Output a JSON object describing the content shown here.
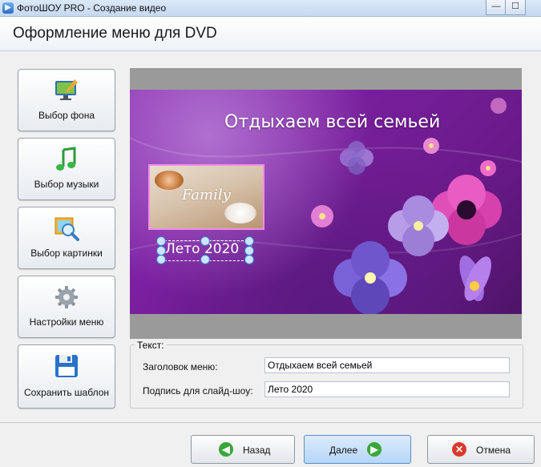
{
  "window": {
    "title": "ФотоШОУ PRO - Создание видео",
    "icon": "app-logo-icon",
    "min_label": "—",
    "max_label": "☐"
  },
  "header": {
    "title": "Оформление меню для DVD"
  },
  "sidebar": {
    "items": [
      {
        "label": "Выбор фона",
        "icon": "monitor-brush-icon"
      },
      {
        "label": "Выбор музыки",
        "icon": "music-note-icon"
      },
      {
        "label": "Выбор картинки",
        "icon": "picture-magnifier-icon"
      },
      {
        "label": "Настройки меню",
        "icon": "gear-icon"
      },
      {
        "label": "Сохранить шаблон",
        "icon": "floppy-disk-icon"
      }
    ]
  },
  "preview": {
    "menu_title": "Отдыхаем всей семьей",
    "thumbnail_text": "Family",
    "caption": "Лето 2020"
  },
  "text_panel": {
    "legend": "Текст:",
    "title_label": "Заголовок меню:",
    "title_value": "Отдыхаем всей семьей",
    "caption_label": "Подпись для слайд-шоу:",
    "caption_value": "Лето 2020"
  },
  "footer": {
    "back_label": "Назад",
    "next_label": "Далее",
    "cancel_label": "Отмена",
    "back_icon": "arrow-left-icon",
    "next_icon": "arrow-right-icon",
    "cancel_icon": "close-icon"
  },
  "colors": {
    "accent": "#3a8f2f",
    "cancel": "#d83a2c",
    "background": "#7a1f9f"
  }
}
